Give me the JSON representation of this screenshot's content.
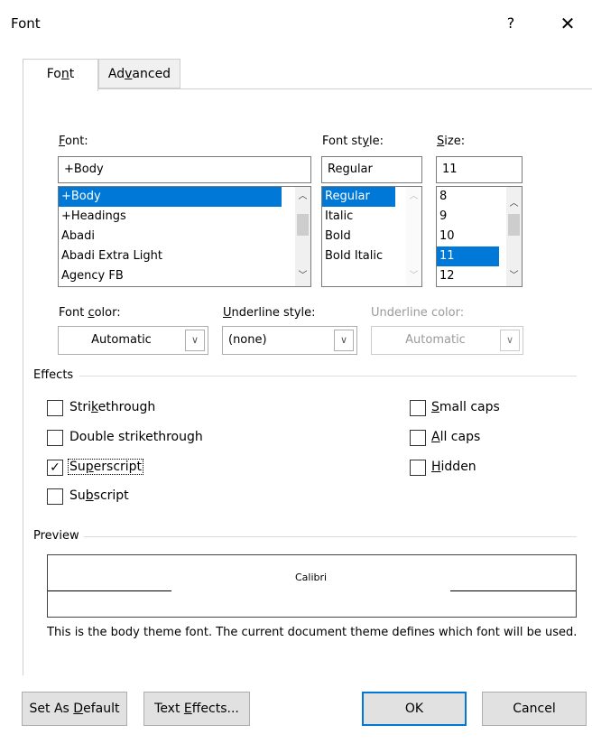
{
  "dialog": {
    "title": "Font",
    "help_glyph": "?",
    "close_glyph": "✕"
  },
  "tabs": [
    {
      "label_pre": "Fo",
      "label_key": "n",
      "label_post": "t",
      "active": true
    },
    {
      "label_pre": "Ad",
      "label_key": "v",
      "label_post": "anced",
      "active": false
    }
  ],
  "font": {
    "label_key": "F",
    "label_post": "ont:",
    "value": "+Body",
    "items": [
      "+Body",
      "+Headings",
      "Abadi",
      "Abadi Extra Light",
      "Agency FB"
    ],
    "selected_index": 0
  },
  "font_style": {
    "label": "Font st",
    "label_key": "y",
    "label_post": "le:",
    "value": "Regular",
    "items": [
      "Regular",
      "Italic",
      "Bold",
      "Bold Italic"
    ],
    "selected_index": 0
  },
  "size": {
    "label_key": "S",
    "label_post": "ize:",
    "value": "11",
    "items": [
      "8",
      "9",
      "10",
      "11",
      "12"
    ],
    "selected_index": 3
  },
  "font_color": {
    "label_pre": "Font ",
    "label_key": "c",
    "label_post": "olor:",
    "value": "Automatic"
  },
  "underline_style": {
    "label_key": "U",
    "label_post": "nderline style:",
    "value": "(none)"
  },
  "underline_color": {
    "label": "Underline color:",
    "value": "Automatic"
  },
  "effects": {
    "heading": "Effects",
    "strikethrough": {
      "pre": "Stri",
      "key": "k",
      "post": "ethrough",
      "checked": false
    },
    "double_strikethrough": {
      "label": "Double strikethrough",
      "checked": false
    },
    "superscript": {
      "pre": "Su",
      "key": "p",
      "post": "erscript",
      "checked": true
    },
    "subscript": {
      "pre": "Su",
      "key": "b",
      "post": "script",
      "checked": false
    },
    "small_caps": {
      "key": "S",
      "post": "mall caps",
      "checked": false
    },
    "all_caps": {
      "key": "A",
      "post": "ll caps",
      "checked": false
    },
    "hidden": {
      "key": "H",
      "post": "idden",
      "checked": false
    },
    "check_glyph": "✓"
  },
  "preview": {
    "heading": "Preview",
    "sample": "Calibri",
    "description": "This is the body theme font. The current document theme defines which font will be used."
  },
  "buttons": {
    "set_default": {
      "pre": "Set As ",
      "key": "D",
      "post": "efault"
    },
    "text_effects": {
      "pre": "Text ",
      "key": "E",
      "post": "ffects..."
    },
    "ok": "OK",
    "cancel": "Cancel"
  },
  "glyphs": {
    "arrow_up": "▲",
    "arrow_down": "▼",
    "chevron_up": "︿",
    "chevron_down": "﹀",
    "dropdown": "∨"
  },
  "colors": {
    "selection": "#0078d7",
    "default_button_border": "#0078d7"
  }
}
